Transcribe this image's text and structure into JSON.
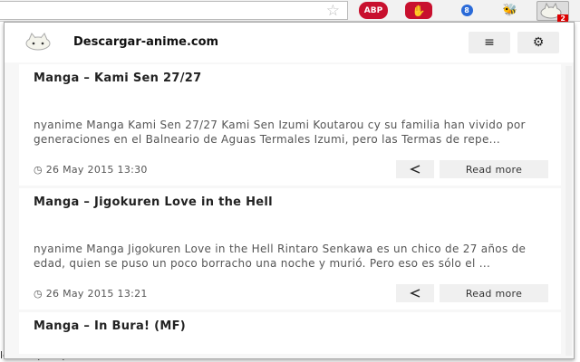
{
  "toolbar": {
    "star": "☆",
    "abp": "ABP",
    "stop": "✋",
    "blue_count": "8",
    "bee": "🐝",
    "badge": "2"
  },
  "background_text": "lene, aqele que no debes utilizar",
  "popup": {
    "site_name": "Descargar-anime.com",
    "list_icon": "≡",
    "settings_icon": "⚙",
    "posts": [
      {
        "title": "Manga – Kami Sen 27/27",
        "excerpt": "nyanime Manga Kami Sen 27/27 Kami Sen Izumi Koutarou cy su familia han vivido por generaciones en el Balneario de Aguas Termales Izumi, pero las Termas de repe...",
        "date": "26 May 2015 13:30",
        "read_more": "Read more"
      },
      {
        "title": "Manga – Jigokuren Love in the Hell",
        "excerpt": "nyanime Manga Jigokuren Love in the Hell Rintaro Senkawa es un chico de 27 años de edad, quien se puso un poco borracho una noche y murió. Pero eso es sólo el ...",
        "date": "26 May 2015 13:21",
        "read_more": "Read more"
      },
      {
        "title": "Manga – In Bura! (MF)"
      }
    ]
  }
}
